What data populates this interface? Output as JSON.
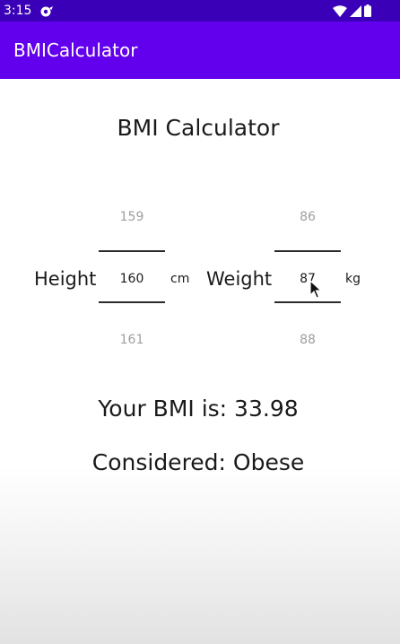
{
  "status_bar": {
    "time": "3:15",
    "icons": [
      "app-notification-icon",
      "wifi-icon",
      "signal-icon",
      "battery-icon"
    ]
  },
  "app_bar": {
    "title": "BMICalculator",
    "color": "#6200ee"
  },
  "main": {
    "title": "BMI Calculator",
    "height": {
      "label": "Height",
      "unit": "cm",
      "prev": "159",
      "value": "160",
      "next": "161"
    },
    "weight": {
      "label": "Weight",
      "unit": "kg",
      "prev": "86",
      "value": "87",
      "next": "88"
    },
    "bmi_text": "Your BMI is: 33.98",
    "category_text": "Considered: Obese"
  }
}
